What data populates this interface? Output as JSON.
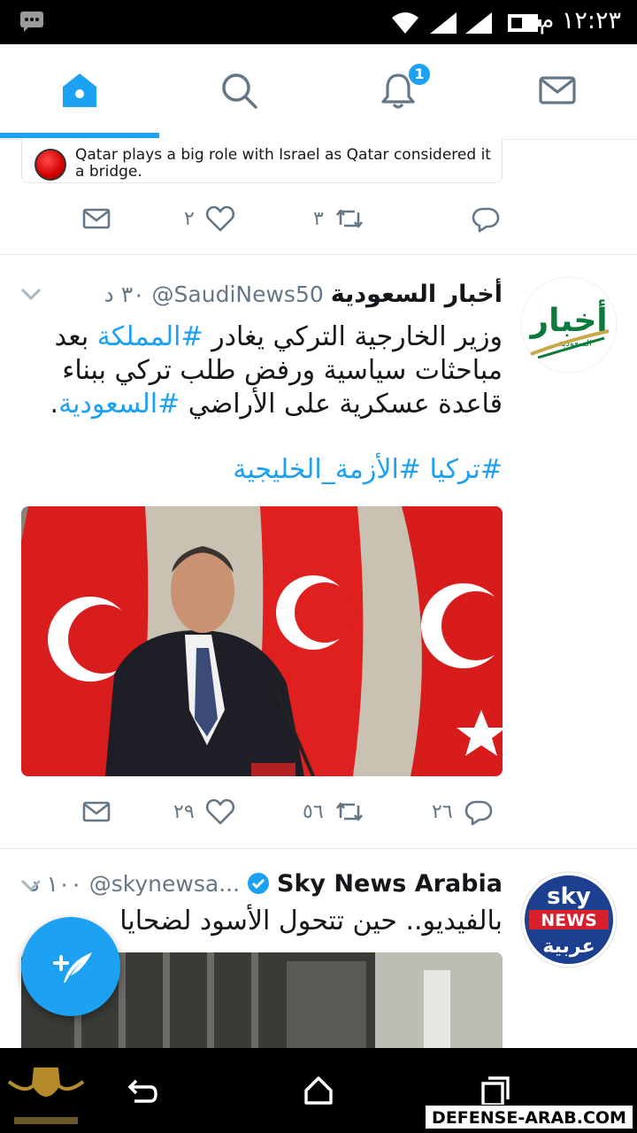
{
  "status_bar": {
    "time": "١٢:٢٣ م"
  },
  "nav": {
    "tabs": [
      {
        "name": "home",
        "icon": "home-icon",
        "active": true
      },
      {
        "name": "search",
        "icon": "search-icon",
        "active": false
      },
      {
        "name": "notifications",
        "icon": "bell-icon",
        "active": false,
        "badge": "1"
      },
      {
        "name": "messages",
        "icon": "mail-icon",
        "active": false
      }
    ],
    "accent_color": "#1da1f2"
  },
  "tweets": [
    {
      "quote_text": "Qatar plays a big role with Israel as Qatar considered it a bridge.",
      "likes": "٢",
      "retweets": "٣",
      "replies": ""
    },
    {
      "name": "أخبار السعودية",
      "handle": "@SaudiNews50",
      "time": "٣٠ د",
      "body_plain_1": "وزير الخارجية التركي يغادر ",
      "hashtag_1": "#المملكة",
      "body_plain_2": " بعد مباحثات سياسية ورفض طلب تركي ببناء قاعدة عسكرية على الأراضي ",
      "hashtag_2": "#السعودية",
      "body_plain_3": ".",
      "hashtags_line": "#تركيا #الأزمة_الخليجية",
      "likes": "٢٩",
      "retweets": "٥٦",
      "replies": "٢٦",
      "avatar_text": "أخبار",
      "avatar_subtext": "السعودية"
    },
    {
      "name": "Sky News Arabia",
      "handle": "@skynewsa...",
      "time": "١٠٠ د",
      "verified": true,
      "body": "بالفيديو.. حين تتحول الأسود لضحايا",
      "avatar_sky": "sky",
      "avatar_news": "NEWS",
      "avatar_arabic": "عربية"
    }
  ],
  "watermark": {
    "site": "DEFENSE-ARAB.COM"
  }
}
